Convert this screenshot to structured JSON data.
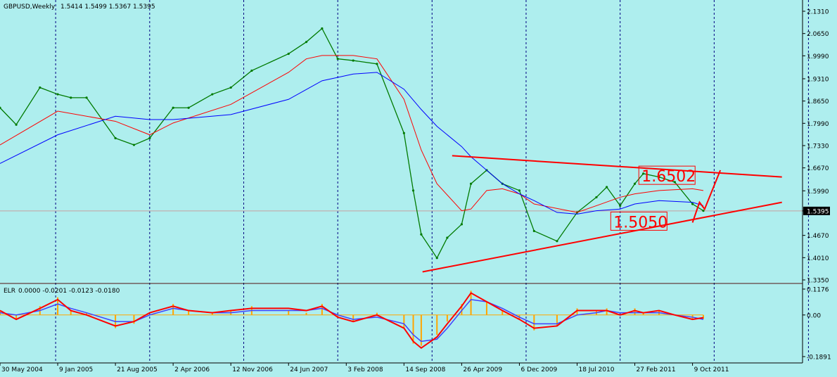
{
  "chart_data": {
    "type": "line",
    "symbol": "GBPUSD,Weekly",
    "ohlc_header": "1.5414 1.5499 1.5367 1.5395",
    "current_price": "1.5395",
    "colors": {
      "background": "#aeeeee",
      "grid": "#000080",
      "price": "#007a00",
      "ma_fast": "#ff0000",
      "ma_slow": "#0000ff",
      "trendline": "#ff0000",
      "elr_hist": "#ffa500",
      "elr_signal": "#ff0000",
      "elr_slow": "#4040ff"
    },
    "price_axis": {
      "ylim": [
        1.335,
        2.131
      ],
      "ticks": [
        "2.1310",
        "2.0650",
        "1.9990",
        "1.9310",
        "1.8650",
        "1.7990",
        "1.7330",
        "1.6670",
        "1.5990",
        "1.5395",
        "1.4670",
        "1.4010",
        "1.3350"
      ]
    },
    "x_axis": {
      "start": "2004-05-30",
      "end": "2012-12-09",
      "ticks": [
        {
          "label": "30 May 2004",
          "date": "2004-05-30"
        },
        {
          "label": "9 Jan 2005",
          "date": "2005-01-09"
        },
        {
          "label": "21 Aug 2005",
          "date": "2005-08-21"
        },
        {
          "label": "2 Apr 2006",
          "date": "2006-04-02"
        },
        {
          "label": "12 Nov 2006",
          "date": "2006-11-12"
        },
        {
          "label": "24 Jun 2007",
          "date": "2007-06-24"
        },
        {
          "label": "3 Feb 2008",
          "date": "2008-02-03"
        },
        {
          "label": "14 Sep 2008",
          "date": "2008-09-14"
        },
        {
          "label": "26 Apr 2009",
          "date": "2009-04-26"
        },
        {
          "label": "6 Dec 2009",
          "date": "2009-12-06"
        },
        {
          "label": "18 Jul 2010",
          "date": "2010-07-18"
        },
        {
          "label": "27 Feb 2011",
          "date": "2011-02-27"
        },
        {
          "label": "9 Oct 2011",
          "date": "2011-10-09"
        }
      ],
      "period_separators": [
        "2005-01-01",
        "2006-01-01",
        "2007-01-01",
        "2008-01-01",
        "2009-01-01",
        "2010-01-01",
        "2011-01-01",
        "2012-01-01",
        "2013-01-01"
      ]
    },
    "price_series": {
      "name": "GBPUSD",
      "x": [
        "2004-05-30",
        "2004-08-01",
        "2004-11-01",
        "2005-01-09",
        "2005-03-01",
        "2005-05-01",
        "2005-08-21",
        "2005-11-01",
        "2006-01-01",
        "2006-04-02",
        "2006-06-01",
        "2006-09-01",
        "2006-11-12",
        "2007-02-01",
        "2007-06-24",
        "2007-09-01",
        "2007-11-01",
        "2008-01-01",
        "2008-03-01",
        "2008-06-01",
        "2008-09-14",
        "2008-10-20",
        "2008-11-20",
        "2009-01-20",
        "2009-03-01",
        "2009-04-26",
        "2009-06-01",
        "2009-08-01",
        "2009-10-01",
        "2009-12-06",
        "2010-02-01",
        "2010-05-01",
        "2010-07-18",
        "2010-10-01",
        "2010-11-10",
        "2011-01-01",
        "2011-02-27",
        "2011-04-01",
        "2011-06-01",
        "2011-08-01",
        "2011-10-09",
        "2011-11-20"
      ],
      "y": [
        1.845,
        1.795,
        1.905,
        1.885,
        1.875,
        1.875,
        1.755,
        1.735,
        1.755,
        1.845,
        1.845,
        1.885,
        1.905,
        1.955,
        2.005,
        2.04,
        2.08,
        1.99,
        1.985,
        1.975,
        1.77,
        1.6,
        1.47,
        1.4,
        1.46,
        1.5,
        1.62,
        1.66,
        1.62,
        1.6,
        1.48,
        1.45,
        1.535,
        1.58,
        1.61,
        1.555,
        1.62,
        1.65,
        1.64,
        1.625,
        1.56,
        1.54
      ]
    },
    "ma_series": [
      {
        "x": [
          "2004-05-30",
          "2005-01-09",
          "2005-08-21",
          "2006-01-01",
          "2006-04-02",
          "2006-11-12",
          "2007-06-24",
          "2007-09-01",
          "2007-11-01",
          "2008-03-01",
          "2008-06-01",
          "2008-09-14",
          "2008-11-20",
          "2009-01-20",
          "2009-04-26",
          "2009-06-01",
          "2009-08-01",
          "2009-10-01",
          "2009-12-06",
          "2010-02-01",
          "2010-07-18",
          "2010-10-01",
          "2011-01-01",
          "2011-02-27",
          "2011-06-01",
          "2011-10-09",
          "2011-11-20"
        ],
        "y": [
          1.735,
          1.835,
          1.805,
          1.765,
          1.8,
          1.855,
          1.95,
          1.99,
          2.0,
          2.0,
          1.99,
          1.87,
          1.72,
          1.62,
          1.54,
          1.545,
          1.6,
          1.605,
          1.59,
          1.56,
          1.535,
          1.555,
          1.58,
          1.59,
          1.6,
          1.605,
          1.6
        ]
      },
      {
        "x": [
          "2004-05-30",
          "2005-01-09",
          "2005-08-21",
          "2006-01-01",
          "2006-04-02",
          "2006-11-12",
          "2007-06-24",
          "2007-11-01",
          "2008-03-01",
          "2008-06-01",
          "2008-09-14",
          "2008-11-20",
          "2009-01-20",
          "2009-04-26",
          "2009-06-01",
          "2009-08-01",
          "2009-10-01",
          "2009-12-06",
          "2010-02-01",
          "2010-05-01",
          "2010-07-18",
          "2010-10-01",
          "2011-01-01",
          "2011-02-27",
          "2011-06-01",
          "2011-10-09",
          "2011-11-20"
        ],
        "y": [
          1.68,
          1.765,
          1.82,
          1.81,
          1.81,
          1.825,
          1.87,
          1.925,
          1.945,
          1.95,
          1.9,
          1.84,
          1.79,
          1.73,
          1.7,
          1.66,
          1.62,
          1.59,
          1.57,
          1.535,
          1.53,
          1.54,
          1.545,
          1.56,
          1.57,
          1.565,
          1.555
        ]
      }
    ],
    "trendlines": [
      {
        "x": [
          "2009-03-20",
          "2012-09-20"
        ],
        "y": [
          1.703,
          1.64
        ]
      },
      {
        "x": [
          "2008-11-25",
          "2012-09-20"
        ],
        "y": [
          1.359,
          1.565
        ]
      },
      {
        "x": [
          "2011-10-09",
          "2011-11-05",
          "2011-11-25",
          "2012-01-25"
        ],
        "y": [
          1.505,
          1.565,
          1.545,
          1.66
        ]
      }
    ],
    "annotations": [
      {
        "text": "1.6502",
        "x": "2011-03-20",
        "y": 1.641
      },
      {
        "text": "1.5050",
        "x": "2010-12-01",
        "y": 1.505
      }
    ],
    "indicator": {
      "name": "ELR",
      "header_values": "0.0000 -0.0201 -0.0123 -0.0180",
      "ylim": [
        -0.1891,
        0.1176
      ],
      "ticks": [
        "0.1176",
        "0.00",
        "-0.1891"
      ],
      "x": [
        "2004-05-30",
        "2004-08-01",
        "2004-11-01",
        "2005-01-09",
        "2005-03-01",
        "2005-05-01",
        "2005-08-21",
        "2005-11-01",
        "2006-01-01",
        "2006-04-02",
        "2006-06-01",
        "2006-09-01",
        "2006-11-12",
        "2007-02-01",
        "2007-06-24",
        "2007-09-01",
        "2007-11-01",
        "2008-01-01",
        "2008-03-01",
        "2008-06-01",
        "2008-09-14",
        "2008-10-20",
        "2008-11-20",
        "2009-01-20",
        "2009-03-01",
        "2009-04-26",
        "2009-06-01",
        "2009-08-01",
        "2009-10-01",
        "2009-12-06",
        "2010-02-01",
        "2010-05-01",
        "2010-07-18",
        "2010-10-01",
        "2010-11-10",
        "2011-01-01",
        "2011-02-27",
        "2011-04-01",
        "2011-06-01",
        "2011-08-01",
        "2011-10-09",
        "2011-11-20"
      ],
      "hist": [
        0.02,
        -0.02,
        0.04,
        0.08,
        0.02,
        0.01,
        -0.06,
        -0.04,
        0.0,
        0.05,
        0.02,
        0.01,
        0.02,
        0.04,
        0.02,
        0.01,
        0.05,
        -0.01,
        -0.03,
        0.01,
        -0.06,
        -0.13,
        -0.14,
        -0.09,
        -0.03,
        0.05,
        0.11,
        0.06,
        0.02,
        -0.02,
        -0.07,
        -0.05,
        0.03,
        0.02,
        0.03,
        0.0,
        0.03,
        0.01,
        0.02,
        0.0,
        -0.02,
        -0.018
      ],
      "signal": [
        0.02,
        -0.02,
        0.03,
        0.07,
        0.02,
        0.0,
        -0.05,
        -0.03,
        0.01,
        0.04,
        0.02,
        0.01,
        0.02,
        0.03,
        0.03,
        0.02,
        0.04,
        -0.01,
        -0.03,
        0.0,
        -0.06,
        -0.12,
        -0.15,
        -0.1,
        -0.04,
        0.04,
        0.1,
        0.06,
        0.02,
        -0.02,
        -0.06,
        -0.05,
        0.02,
        0.02,
        0.02,
        0.0,
        0.02,
        0.01,
        0.02,
        0.0,
        -0.02,
        -0.0123
      ],
      "slow": [
        0.01,
        0.0,
        0.02,
        0.05,
        0.03,
        0.01,
        -0.03,
        -0.03,
        0.0,
        0.03,
        0.02,
        0.01,
        0.01,
        0.02,
        0.02,
        0.02,
        0.03,
        0.0,
        -0.02,
        -0.01,
        -0.04,
        -0.09,
        -0.12,
        -0.11,
        -0.06,
        0.02,
        0.07,
        0.06,
        0.03,
        -0.01,
        -0.04,
        -0.04,
        0.0,
        0.01,
        0.02,
        0.01,
        0.01,
        0.01,
        0.01,
        0.0,
        -0.01,
        -0.0201
      ]
    }
  }
}
